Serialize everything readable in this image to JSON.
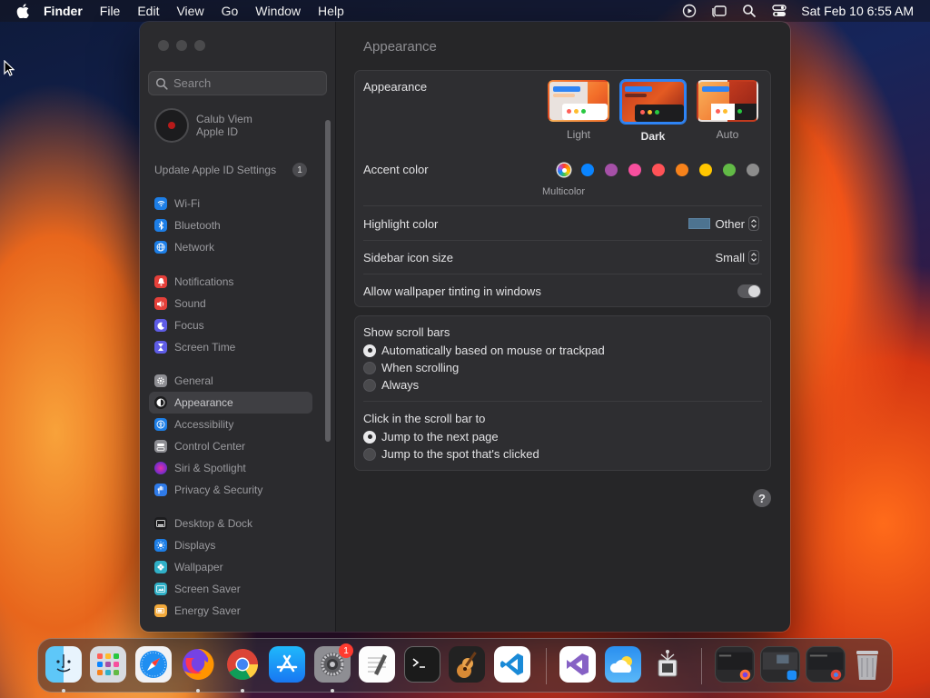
{
  "menubar": {
    "app_name": "Finder",
    "menus": [
      "File",
      "Edit",
      "View",
      "Go",
      "Window",
      "Help"
    ],
    "clock": "Sat Feb 10  6:55 AM",
    "status_icons": [
      "screen-record-icon",
      "stage-manager-icon",
      "spotlight-search-icon",
      "control-center-icon"
    ]
  },
  "sidebar": {
    "search_placeholder": "Search",
    "profile_name": "Calub Viem",
    "profile_subtitle": "Apple ID",
    "update_label": "Update Apple ID Settings",
    "update_count": "1",
    "items": [
      {
        "label": "Wi-Fi",
        "color": "#1d7ee6"
      },
      {
        "label": "Bluetooth",
        "color": "#1d7ee6"
      },
      {
        "label": "Network",
        "color": "#1d7ee6"
      },
      {
        "label": "Notifications",
        "color": "#e5403a"
      },
      {
        "label": "Sound",
        "color": "#e5403a"
      },
      {
        "label": "Focus",
        "color": "#5e5ce6"
      },
      {
        "label": "Screen Time",
        "color": "#5e5ce6"
      },
      {
        "label": "General",
        "color": "#8e8e93"
      },
      {
        "label": "Appearance",
        "color": "#1c1c1e"
      },
      {
        "label": "Accessibility",
        "color": "#1d7ee6"
      },
      {
        "label": "Control Center",
        "color": "#8e8e93"
      },
      {
        "label": "Siri & Spotlight",
        "color": "#6a2bd8"
      },
      {
        "label": "Privacy & Security",
        "color": "#2f7be9"
      },
      {
        "label": "Desktop & Dock",
        "color": "#1c1c1e"
      },
      {
        "label": "Displays",
        "color": "#1d7ee6"
      },
      {
        "label": "Wallpaper",
        "color": "#30b0c7"
      },
      {
        "label": "Screen Saver",
        "color": "#30b0c7"
      },
      {
        "label": "Energy Saver",
        "color": "#f2a93b"
      }
    ],
    "active_item": "Appearance"
  },
  "main": {
    "title": "Appearance",
    "appearance_label": "Appearance",
    "appearance_options": [
      "Light",
      "Dark",
      "Auto"
    ],
    "appearance_selected": "Dark",
    "accent_label": "Accent color",
    "accent_colors": [
      "multicolor",
      "#0a84ff",
      "#a550a7",
      "#f74f9e",
      "#ff5257",
      "#f7821b",
      "#ffc600",
      "#62ba46",
      "#8c8c8c"
    ],
    "accent_selected_label": "Multicolor",
    "highlight_label": "Highlight color",
    "highlight_value": "Other",
    "highlight_color": "#4d7390",
    "sidebar_icon_label": "Sidebar icon size",
    "sidebar_icon_value": "Small",
    "tinting_label": "Allow wallpaper tinting in windows",
    "tinting_on": true,
    "scroll_bars_label": "Show scroll bars",
    "scroll_bars_options": [
      "Automatically based on mouse or trackpad",
      "When scrolling",
      "Always"
    ],
    "scroll_bars_selected": 0,
    "click_label": "Click in the scroll bar to",
    "click_options": [
      "Jump to the next page",
      "Jump to the spot that's clicked"
    ],
    "click_selected": 0,
    "help_label": "?"
  },
  "dock": {
    "apps": [
      "finder-icon",
      "launchpad-icon",
      "safari-icon",
      "firefox-icon",
      "chrome-icon",
      "app-store-icon",
      "system-settings-icon",
      "textedit-icon",
      "terminal-icon",
      "garageband-icon",
      "vscode-icon",
      "visual-studio-icon",
      "weather-icon",
      "system-information-icon"
    ],
    "settings_badge": "1",
    "recent_windows": [
      "window-thumbnail-firefox",
      "window-thumbnail-app-store",
      "window-thumbnail-chrome"
    ],
    "trash": "trash-icon"
  }
}
